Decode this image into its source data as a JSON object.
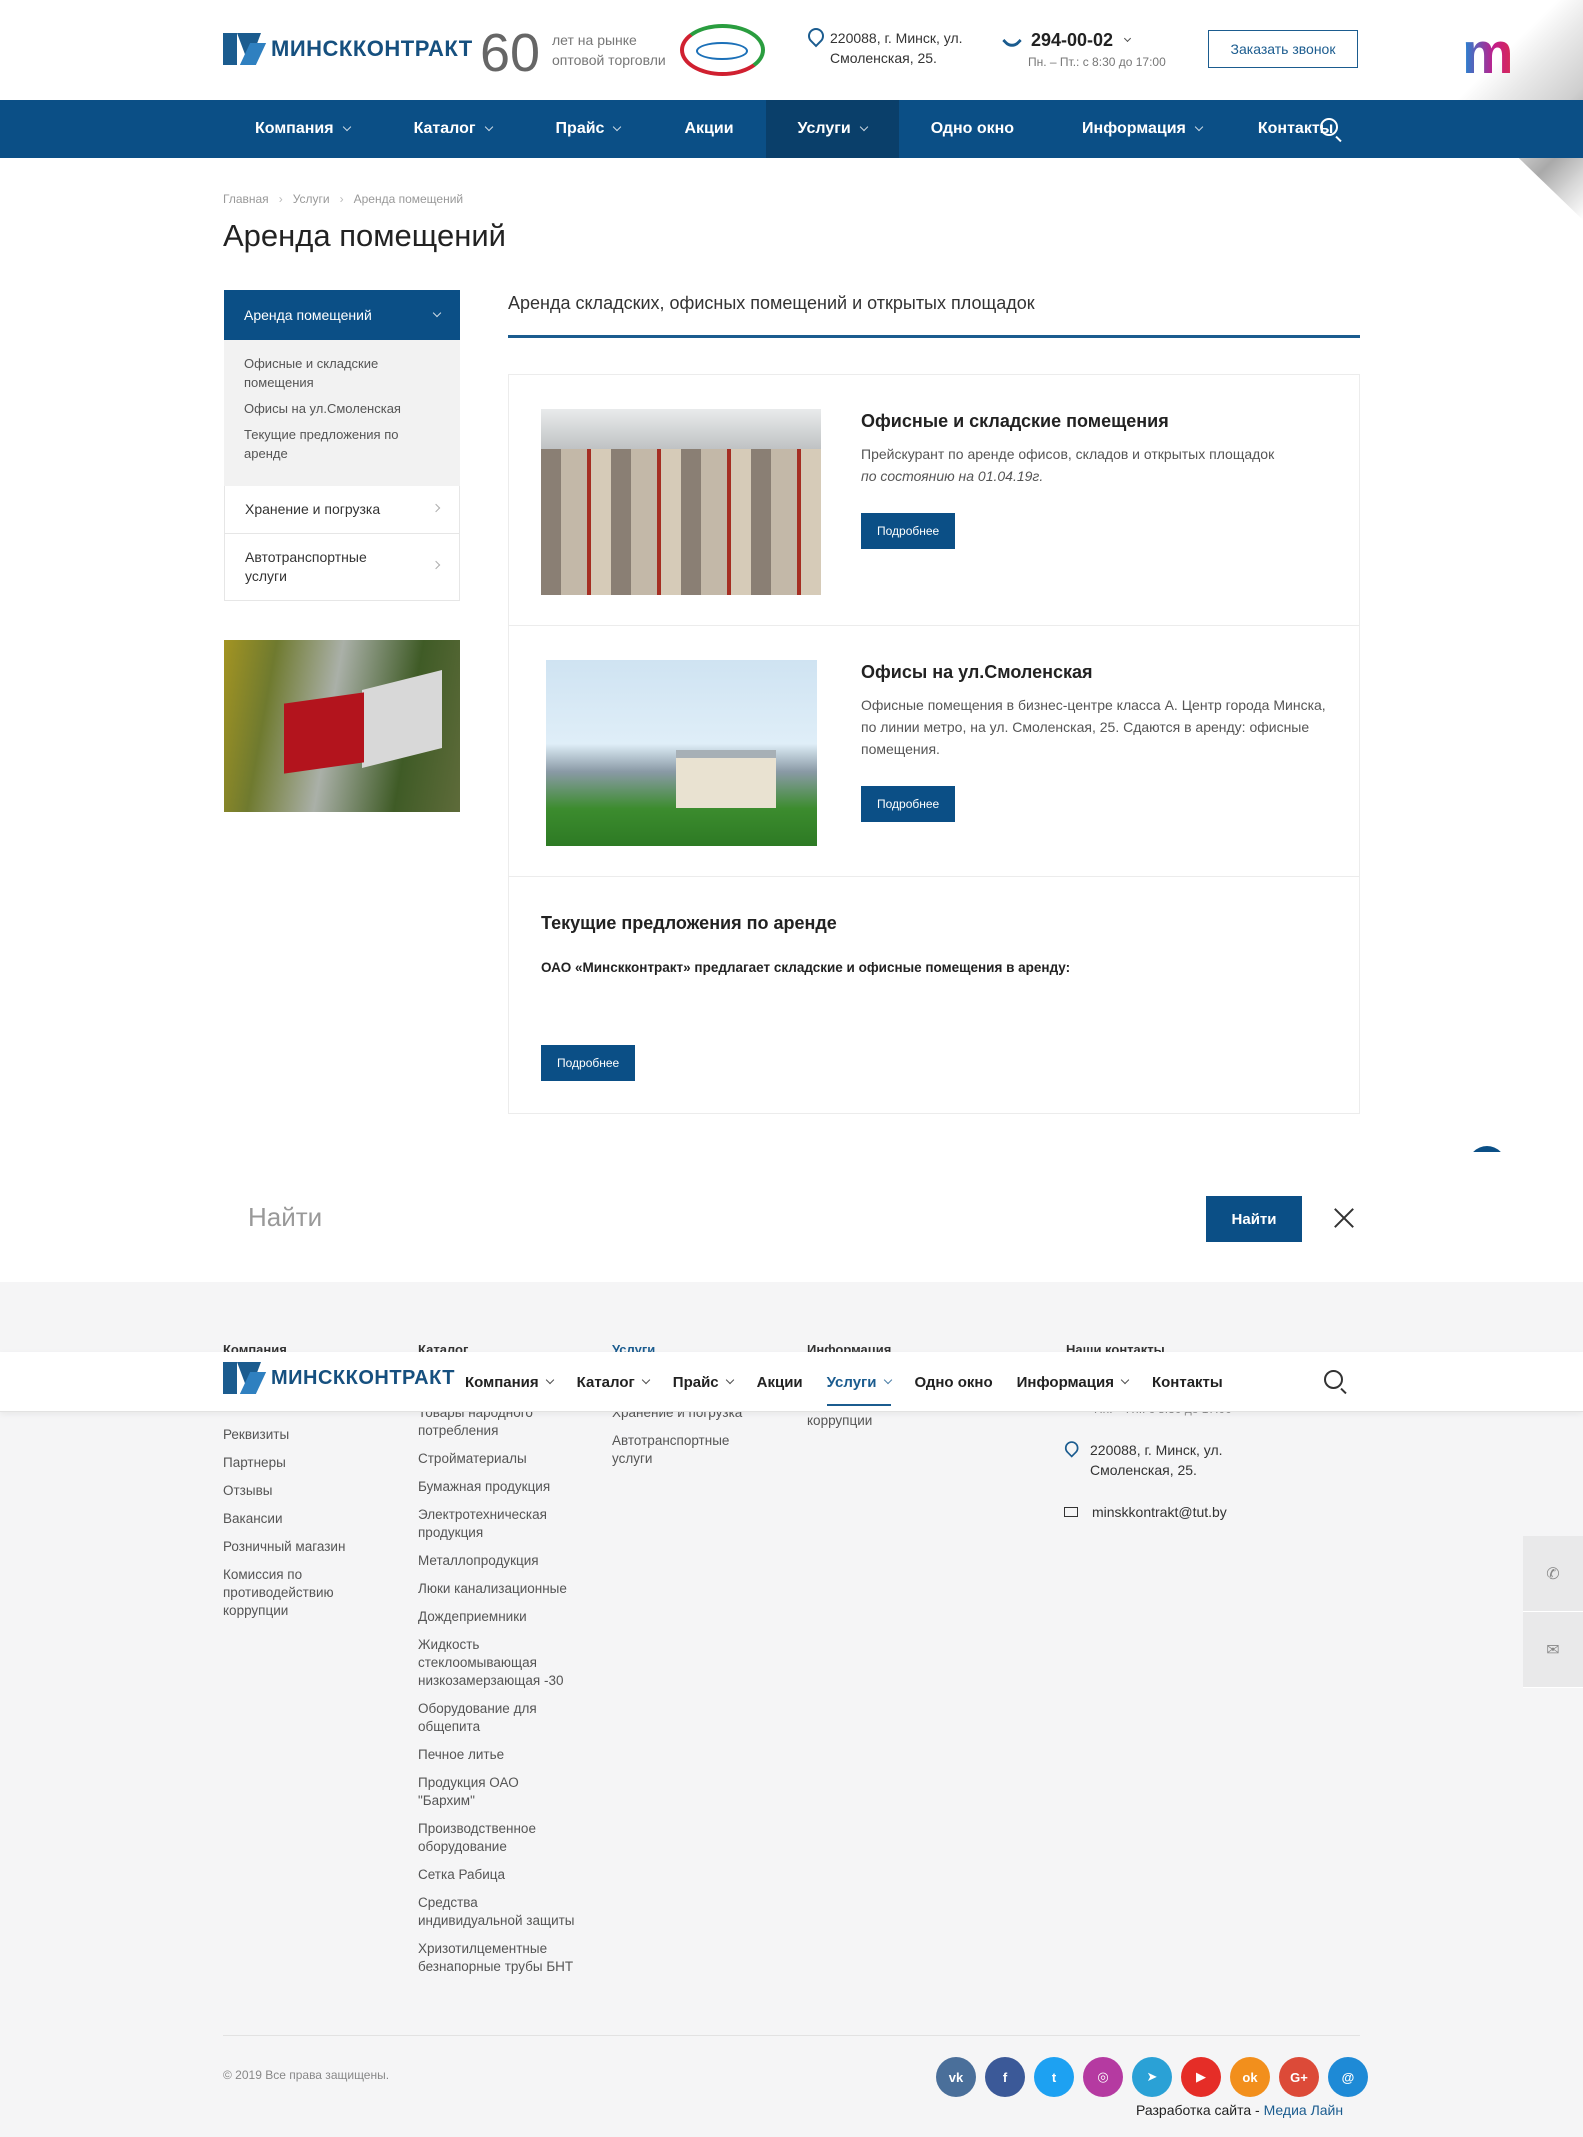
{
  "header": {
    "logo_text": "МИНСККОНТРАКТ",
    "years": "60",
    "years_text": "лет на рынке оптовой торговли",
    "address_line1": "220088, г. Минск, ул.",
    "address_line2": "Смоленская, 25.",
    "phone": "294-00-02",
    "hours": "Пн. – Пт.: с 8:30 до 17:00",
    "callback_button": "Заказать звонок"
  },
  "nav": {
    "items": [
      {
        "label": "Компания"
      },
      {
        "label": "Каталог"
      },
      {
        "label": "Прайс"
      },
      {
        "label": "Акции"
      },
      {
        "label": "Услуги"
      },
      {
        "label": "Одно окно"
      },
      {
        "label": "Информация"
      },
      {
        "label": "Контакты"
      }
    ]
  },
  "breadcrumb": {
    "home": "Главная",
    "section": "Услуги",
    "current": "Аренда помещений"
  },
  "page_title": "Аренда помещений",
  "sidebar": {
    "active": "Аренда помещений",
    "sub_items": [
      "Офисные и складские помещения",
      "Офисы на ул.Смоленская",
      "Текущие предложения по аренде"
    ],
    "items": [
      "Хранение и погрузка",
      "Автотранспортные услуги"
    ]
  },
  "main": {
    "subtitle": "Аренда складских, офисных помещений и открытых площадок",
    "cards": [
      {
        "title": "Офисные и складские помещения",
        "text": "Прейскурант по аренде офисов, складов и открытых площадок",
        "text_italic": "по состоянию на 01.04.19г.",
        "button": "Подробнее"
      },
      {
        "title": "Офисы на ул.Смоленская",
        "text": "Офисные помещения в бизнес-центре класса А. Центр города Минска, по линии метро, на ул. Смоленская, 25. Сдаются в аренду: офисные помещения.",
        "button": "Подробнее"
      },
      {
        "title": "Текущие предложения по аренде",
        "text": "ОАО «Минскконтракт» предлагает складские и офисные помещения в аренду:",
        "button": "Подробнее"
      }
    ]
  },
  "search": {
    "placeholder": "Найти",
    "button": "Найти"
  },
  "footer": {
    "headings": [
      "Компания",
      "Каталог",
      "Услуги",
      "Информация",
      "Наши контакты"
    ],
    "company_links": [
      "Реквизиты",
      "Партнеры",
      "Отзывы",
      "Вакансии",
      "Розничный магазин",
      "Комиссия по противодействию коррупции"
    ],
    "catalog_links": [
      "Товары народного потребления",
      "Стройматериалы",
      "Бумажная продукция",
      "Электротехническая продукция",
      "Металлопродукция",
      "Люки канализационные",
      "Дождеприемники",
      "Жидкость стеклоомывающая низкозамерзающая -30",
      "Оборудование для общепита",
      "Печное литье",
      "Продукция ОАО \"Бархим\"",
      "Производственное оборудование",
      "Сетка Рабица",
      "Средства индивидуальной защиты",
      "Хризотилцементные безнапорные трубы БНТ"
    ],
    "services_links": [
      "Хранение и погрузка",
      "Автотранспортные услуги"
    ],
    "info_links": [
      "коррупции"
    ],
    "contact_hours": "Пн. – Пт.: с 8:30 до 17:00",
    "contact_address_line1": "220088, г. Минск, ул.",
    "contact_address_line2": "Смоленская, 25.",
    "contact_email": "minskkontrakt@tut.by",
    "copyright": "© 2019 Все права защищены.",
    "dev_prefix": "Разработка сайта - ",
    "dev_name": "Медиа Лайн"
  },
  "socials": [
    {
      "icon": "vk-icon",
      "glyph": "vk",
      "color": "#4a6f9a"
    },
    {
      "icon": "facebook-icon",
      "glyph": "f",
      "color": "#3b5998"
    },
    {
      "icon": "twitter-icon",
      "glyph": "t",
      "color": "#1da1f2"
    },
    {
      "icon": "instagram-icon",
      "glyph": "◎",
      "color": "#b53aa1"
    },
    {
      "icon": "telegram-icon",
      "glyph": "➤",
      "color": "#2aa1d6"
    },
    {
      "icon": "youtube-icon",
      "glyph": "▶",
      "color": "#e52d27"
    },
    {
      "icon": "odnoklassniki-icon",
      "glyph": "ok",
      "color": "#f28f1c"
    },
    {
      "icon": "google-plus-icon",
      "glyph": "G+",
      "color": "#dc4a38"
    },
    {
      "icon": "email-icon",
      "glyph": "@",
      "color": "#1e8ad6"
    }
  ]
}
